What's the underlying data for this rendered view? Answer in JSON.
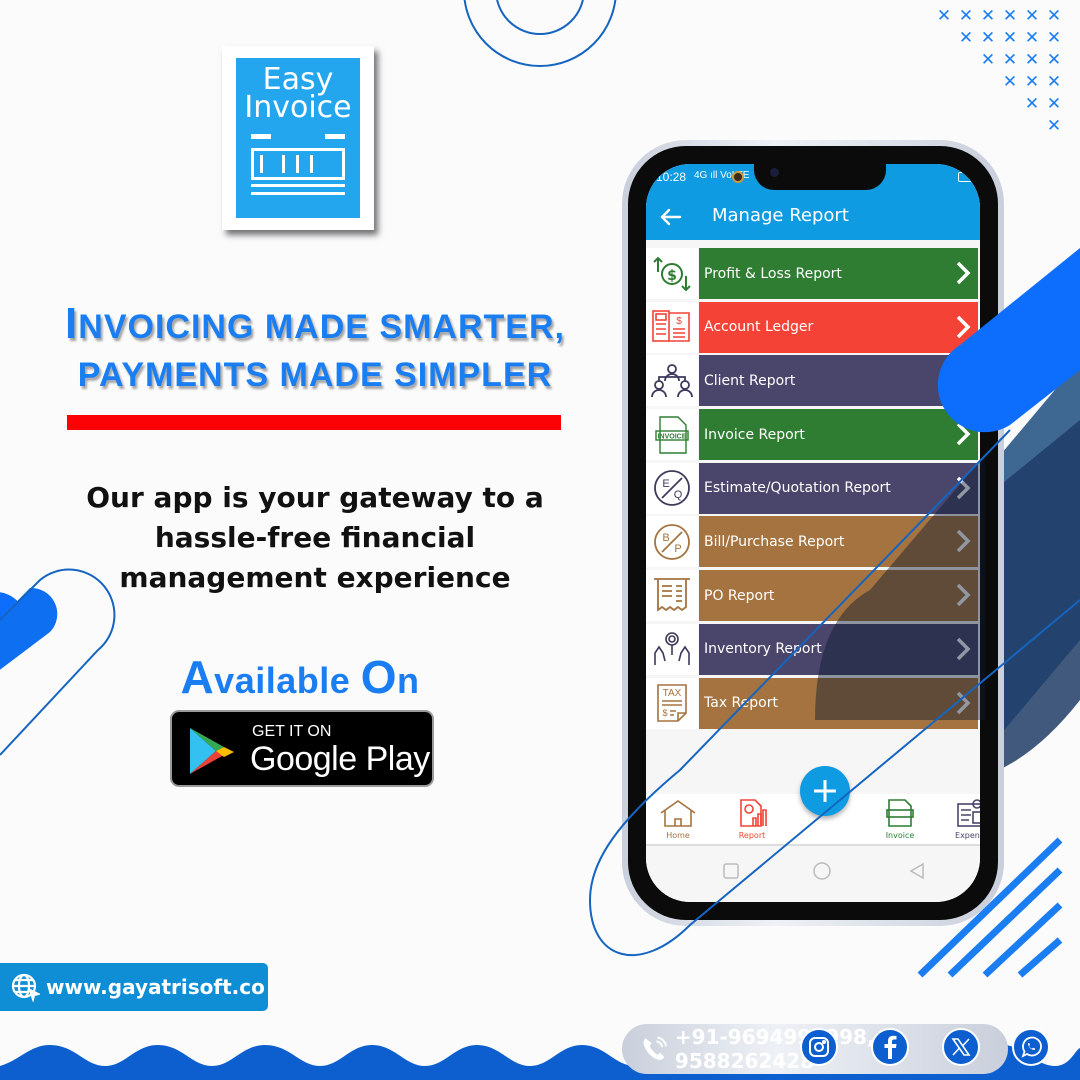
{
  "colors": {
    "brand_blue": "#1a7ef2",
    "deco_blue": "#0d5fd0",
    "app_bar": "#0e9be2",
    "red_bar": "#fb0207",
    "contact_bg": "#0f8ed6",
    "green": "#2e7d32",
    "red": "#f44336",
    "purple": "#4a456a",
    "brown": "#a5733f"
  },
  "logo": {
    "line1": "Easy",
    "line2": "Invoice",
    "icon": "invoice-document-icon"
  },
  "headline": {
    "line1_initial": "I",
    "line1_rest": "nvoicing made smarter,",
    "line2": "payments made simpler"
  },
  "subtitle": {
    "line1": "Our app is your gateway to a",
    "line2": "hassle-free financial",
    "line3": "management experience"
  },
  "available": {
    "a_initial": "A",
    "a_rest": "vailable ",
    "o_initial": "O",
    "o_rest": "n"
  },
  "google_play": {
    "small": "GET IT ON",
    "big": "Google Play",
    "icon": "google-play-icon"
  },
  "contact": {
    "website": "www.gayatrisoft.co",
    "website_icon": "globe-icon",
    "phone": "+91-9694999998, 9588262428",
    "phone_icon": "phone-icon"
  },
  "social": [
    {
      "name": "instagram",
      "icon": "instagram-icon"
    },
    {
      "name": "facebook",
      "icon": "facebook-icon"
    },
    {
      "name": "x",
      "icon": "x-icon"
    },
    {
      "name": "whatsapp",
      "icon": "whatsapp-icon"
    }
  ],
  "phone_screen": {
    "status": {
      "time": "10:28",
      "signal": "4G ıll VoLTE"
    },
    "app_bar": {
      "title": "Manage Report",
      "back_icon": "arrow-left-icon"
    },
    "reports": [
      {
        "label": "Profit & Loss Report",
        "color": "#2e7d32",
        "icon": "profit-loss-icon"
      },
      {
        "label": "Account Ledger",
        "color": "#f44336",
        "icon": "ledger-icon"
      },
      {
        "label": "Client Report",
        "color": "#4a456a",
        "icon": "clients-icon"
      },
      {
        "label": "Invoice Report",
        "color": "#2e7d32",
        "icon": "invoice-icon"
      },
      {
        "label": "Estimate/Quotation Report",
        "color": "#4a456a",
        "icon": "estimate-icon"
      },
      {
        "label": "Bill/Purchase Report",
        "color": "#a5733f",
        "icon": "bill-purchase-icon"
      },
      {
        "label": "PO Report",
        "color": "#a5733f",
        "icon": "receipt-icon"
      },
      {
        "label": "Inventory Report",
        "color": "#4a456a",
        "icon": "inventory-icon"
      },
      {
        "label": "Tax Report",
        "color": "#a5733f",
        "icon": "tax-icon"
      }
    ],
    "bottom_nav": [
      {
        "label": "Home",
        "color": "#a5733f"
      },
      {
        "label": "Report",
        "color": "#f44336"
      },
      {
        "label": "Invoice",
        "color": "#2e7d32"
      },
      {
        "label": "Expense",
        "color": "#4a456a"
      }
    ]
  }
}
